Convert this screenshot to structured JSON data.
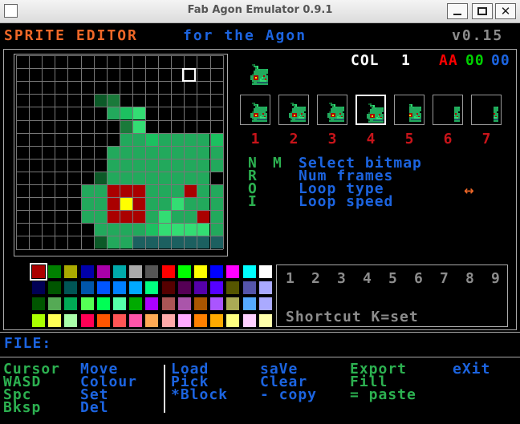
{
  "window": {
    "title": "Fab Agon Emulator 0.9.1"
  },
  "header": {
    "app_name": "SPRITE EDITOR",
    "subtitle": "for the Agon",
    "version": "v0.15"
  },
  "colors": {
    "orange": "#f06828",
    "blue": "#1c64e0",
    "green": "#2cb050",
    "red": "#c8141a",
    "grey": "#8c8c8c",
    "white": "#ffffff"
  },
  "color_info": {
    "label": "COL",
    "index": "1",
    "rgb_r": "AA",
    "rgb_g": "00",
    "rgb_b": "00"
  },
  "frames": [
    "1",
    "2",
    "3",
    "4",
    "5",
    "6",
    "7"
  ],
  "selected_frame": 4,
  "menu_keys": {
    "k1": "N",
    "k2": "R",
    "k3": "O",
    "k4": "I",
    "m": "M"
  },
  "menu_items": [
    "Select bitmap",
    "Num frames",
    "Loop type",
    "Loop speed"
  ],
  "loop_icon": "double-arrow-icon",
  "shortcuts": {
    "numbers": [
      "1",
      "2",
      "3",
      "4",
      "5",
      "6",
      "7",
      "8",
      "9"
    ],
    "hint": "Shortcut K=set"
  },
  "file": {
    "label": "FILE:",
    "value": ""
  },
  "help": {
    "col1": [
      "Cursor",
      "WASD",
      "Spc",
      "Bksp"
    ],
    "col2": [
      "Move",
      "Colour",
      "Set",
      "Del"
    ],
    "col3": [
      "Load",
      "Pick",
      "*Block"
    ],
    "col4": [
      "saVe",
      "Clear",
      "- copy"
    ],
    "col5": [
      "Export",
      "Fill",
      "= paste"
    ],
    "col6": [
      "eXit"
    ]
  },
  "palette": [
    [
      "#aa0000",
      "#008000",
      "#aaaa00",
      "#0000aa",
      "#aa00aa",
      "#00aaaa",
      "#aaaaaa",
      "#555555",
      "#ff0000",
      "#00ff00",
      "#ffff00",
      "#0000ff",
      "#ff00ff",
      "#00ffff",
      "#ffffff"
    ],
    [
      "#000055",
      "#005500",
      "#005555",
      "#0055aa",
      "#0055ff",
      "#0080ff",
      "#00aaff",
      "#00ff80",
      "#550000",
      "#550055",
      "#5500aa",
      "#5500ff",
      "#555500",
      "#5555aa",
      "#aaaaff"
    ],
    [
      "#005500",
      "#55aa55",
      "#00aa55",
      "#55ff55",
      "#00ff55",
      "#55ffaa",
      "#00aa00",
      "#aa00ff",
      "#aa5555",
      "#aa55aa",
      "#aa5500",
      "#aa55ff",
      "#aaaa55",
      "#55aaff",
      "#aaaaff"
    ],
    [
      "#aaff00",
      "#ffff55",
      "#aaffaa",
      "#ff0055",
      "#ff5500",
      "#ff5555",
      "#ff55aa",
      "#ffaa55",
      "#ffaaaa",
      "#ffaaff",
      "#ff8000",
      "#ffaa00",
      "#ffff80",
      "#ffd0ff",
      "#ffffaa"
    ]
  ],
  "selected_palette": [
    0,
    0
  ],
  "sprite_rows": [
    ".....................",
    "....................",
    "..............W.....",
    "......ED...........",
    ".......GJL..........",
    "........DL..........",
    "........GGJGGGGJ....",
    ".......GGGGGGGGG....",
    ".......GGGGGGGGG....",
    "......EGGGGGGGG.....",
    ".....GGRRRGGGRGG....",
    ".....GGRYRGGLGGG....",
    ".....GGRRRGLGGRG....",
    "......GGGGJLLLLG....",
    "......EGGTTTTTTT....",
    "......GGGGGGGGGG....",
    "......EGGGGGGGGG....",
    "......GGGGG.........",
    "......GE............",
    ".....................",
    "....................."
  ],
  "sprite_colors": {
    "G": "#22a95c",
    "E": "#0c5a28",
    "D": "#1a7a3a",
    "J": "#1cc060",
    "L": "#33dd73",
    "R": "#aa0000",
    "Y": "#ffff00",
    "T": "#1c6060"
  }
}
